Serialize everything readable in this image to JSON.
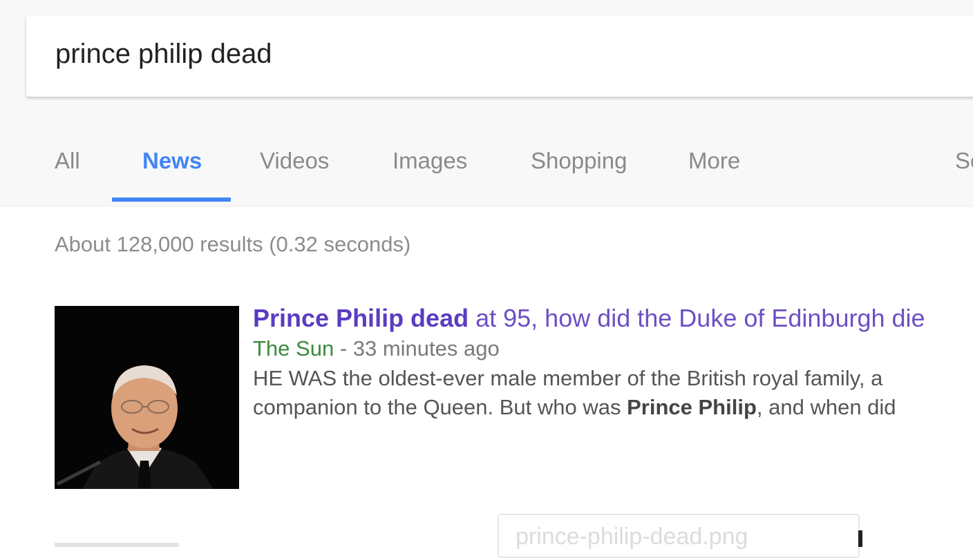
{
  "search": {
    "query": "prince philip dead"
  },
  "tabs": [
    {
      "label": "All"
    },
    {
      "label": "News"
    },
    {
      "label": "Videos"
    },
    {
      "label": "Images"
    },
    {
      "label": "Shopping"
    },
    {
      "label": "More"
    },
    {
      "label": "Se"
    }
  ],
  "active_tab": "News",
  "results_stats": "About 128,000 results (0.32 seconds)",
  "result": {
    "title_bold": "Prince Philip dead",
    "title_rest": " at 95, how did the Duke of Edinburgh die",
    "source": "The Sun",
    "time": " - 33 minutes ago",
    "snippet_line1": "HE WAS the oldest-ever male member of the British royal family, a",
    "snippet_line2_a": "companion to the Queen. But who was ",
    "snippet_line2_bold": "Prince Philip",
    "snippet_line2_b": ", and when did"
  },
  "tooltip": {
    "filename": "prince-philip-dead.png"
  },
  "colors": {
    "accent": "#4285f4",
    "title_visited": "#6d4fc4",
    "source_green": "#3b8a3b",
    "tab_gray": "#8a8a8a"
  }
}
